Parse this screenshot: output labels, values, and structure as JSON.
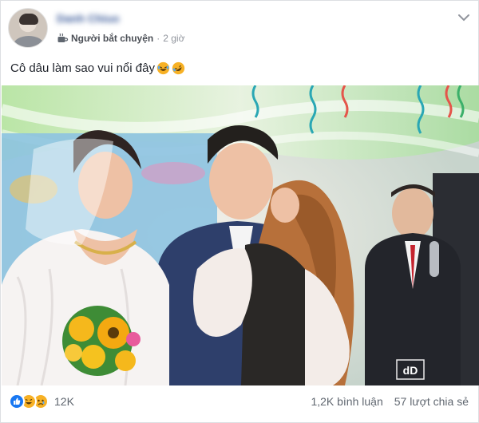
{
  "post": {
    "poster_name": "Danh Chiuo",
    "group_name": "Người bắt chuyện",
    "separator": "·",
    "time": "2 giờ",
    "text": "Cô dâu làm sao vui nổi đây",
    "text_emojis": [
      "rofl-emoji",
      "rofl-emoji"
    ]
  },
  "photo": {
    "watermark": "dD"
  },
  "footer": {
    "reaction_types": [
      "like-icon",
      "haha-icon",
      "sad-icon"
    ],
    "reaction_count": "12K",
    "comments": "1,2K bình luận",
    "shares": "57 lượt chia sẻ"
  },
  "colors": {
    "link": "#385898",
    "secondary_text": "#606770",
    "like_blue": "#1877f2",
    "emoji_yellow": "#f7b125"
  }
}
